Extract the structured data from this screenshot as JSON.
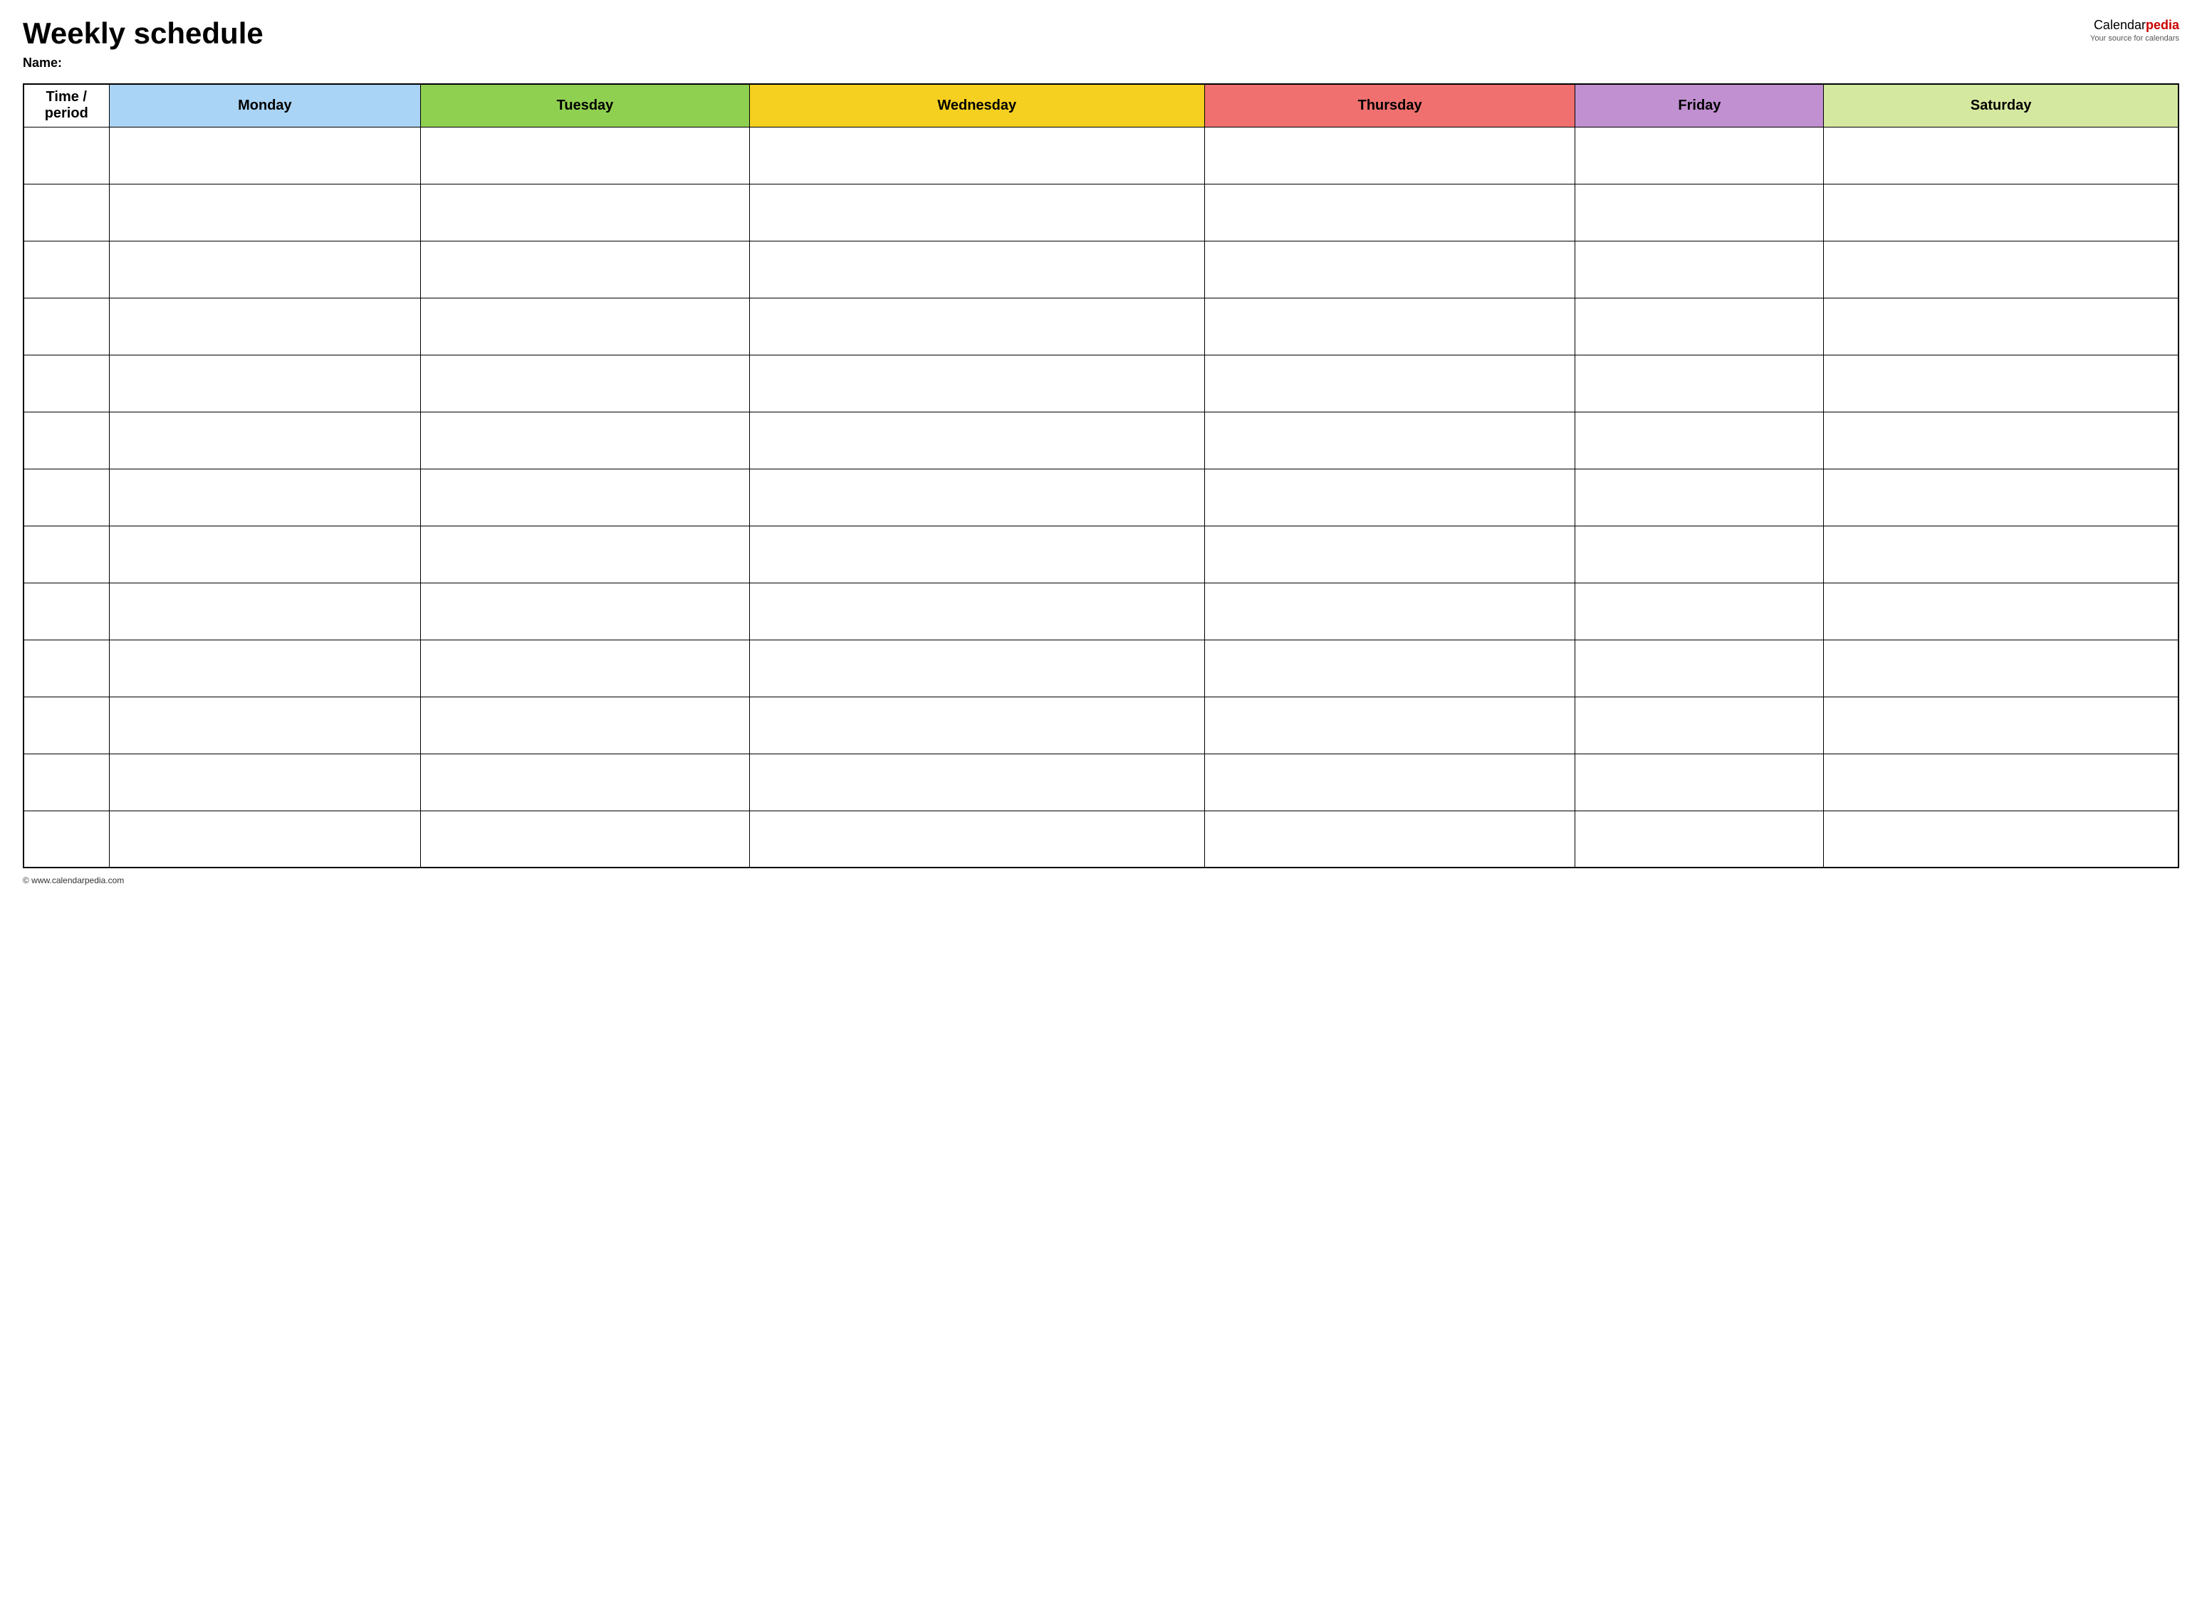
{
  "page": {
    "title": "Weekly schedule",
    "name_label": "Name:",
    "footer_text": "© www.calendarpedia.com"
  },
  "logo": {
    "brand_start": "Calendar",
    "brand_red": "pedia",
    "tagline": "Your source for calendars"
  },
  "table": {
    "headers": [
      {
        "id": "time",
        "label": "Time / period",
        "color_class": "col-time"
      },
      {
        "id": "monday",
        "label": "Monday",
        "color_class": "col-monday"
      },
      {
        "id": "tuesday",
        "label": "Tuesday",
        "color_class": "col-tuesday"
      },
      {
        "id": "wednesday",
        "label": "Wednesday",
        "color_class": "col-wednesday"
      },
      {
        "id": "thursday",
        "label": "Thursday",
        "color_class": "col-thursday"
      },
      {
        "id": "friday",
        "label": "Friday",
        "color_class": "col-friday"
      },
      {
        "id": "saturday",
        "label": "Saturday",
        "color_class": "col-saturday"
      }
    ],
    "row_count": 13
  }
}
